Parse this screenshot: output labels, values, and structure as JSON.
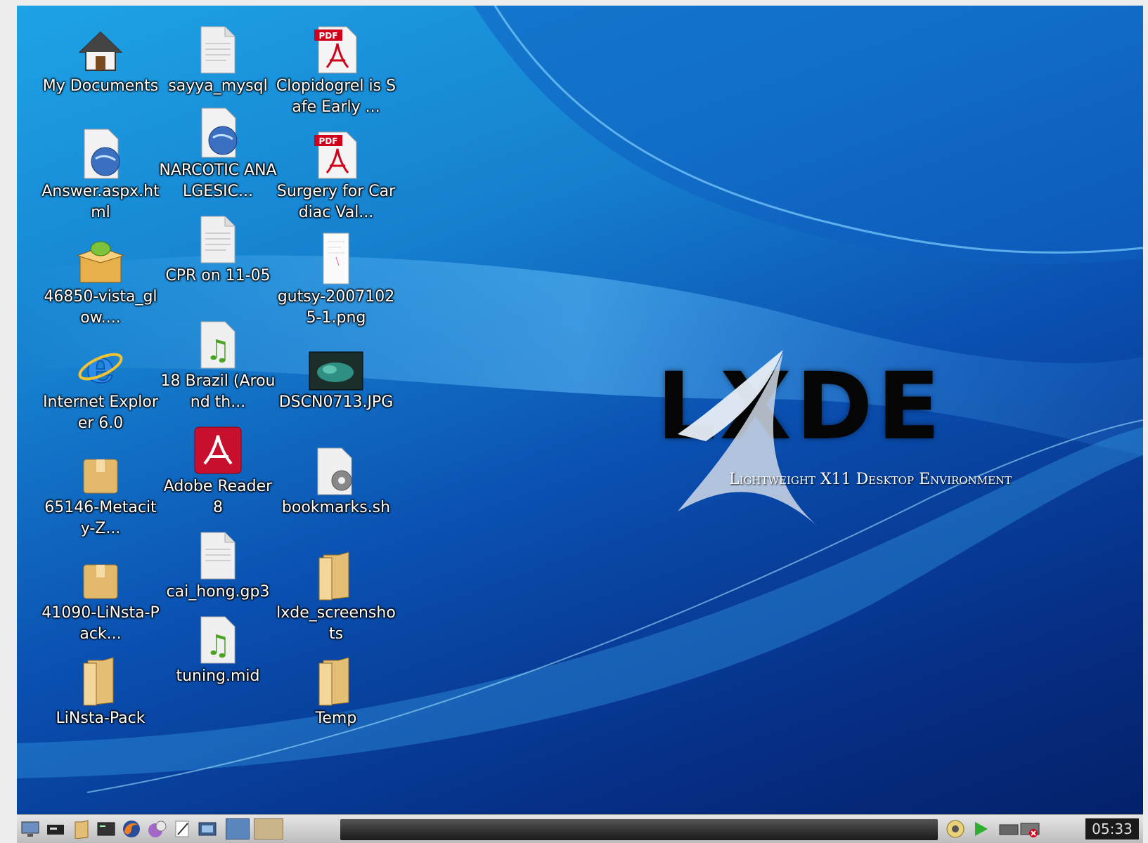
{
  "desktop": {
    "icons": [
      {
        "label": "My Documents",
        "icon": "home-icon"
      },
      {
        "label": "Answer.aspx.html",
        "icon": "html-document-icon"
      },
      {
        "label": "46850-vista_glow....",
        "icon": "package-icon"
      },
      {
        "label": "Internet Explorer 6.0",
        "icon": "internet-explorer-icon"
      },
      {
        "label": "65146-Metacity-Z...",
        "icon": "archive-icon"
      },
      {
        "label": "41090-LiNsta-Pack...",
        "icon": "archive-icon"
      },
      {
        "label": "LiNsta-Pack",
        "icon": "folder-icon"
      },
      {
        "label": "sayya_mysql",
        "icon": "text-file-icon"
      },
      {
        "label": "NARCOTIC ANALGESIC...",
        "icon": "html-document-icon"
      },
      {
        "label": "CPR on 11-05",
        "icon": "text-file-icon"
      },
      {
        "label": "18 Brazil (Around th...",
        "icon": "audio-file-icon"
      },
      {
        "label": "Adobe Reader 8",
        "icon": "adobe-reader-icon"
      },
      {
        "label": "cai_hong.gp3",
        "icon": "text-file-icon"
      },
      {
        "label": "tuning.mid",
        "icon": "audio-file-icon"
      },
      {
        "label": "Clopidogrel is Safe Early ...",
        "icon": "pdf-icon"
      },
      {
        "label": "Surgery for Cardiac Val...",
        "icon": "pdf-icon"
      },
      {
        "label": "gutsy-20071025-1.png",
        "icon": "image-file-icon"
      },
      {
        "label": "DSCN0713.JPG",
        "icon": "photo-thumbnail-icon"
      },
      {
        "label": "bookmarks.sh",
        "icon": "script-icon"
      },
      {
        "label": "lxde_screenshots",
        "icon": "folder-icon"
      },
      {
        "label": "Temp",
        "icon": "folder-icon"
      }
    ]
  },
  "wallpaper": {
    "logo_text": "LXDE",
    "subtitle": "Lightweight X11 Desktop Environment"
  },
  "taskbar": {
    "launchers": [
      "show-desktop-icon",
      "terminal-icon",
      "file-manager-icon",
      "terminal-window-icon",
      "firefox-icon",
      "media-player-icon",
      "text-editor-icon",
      "screenshot-icon",
      "workspace-1",
      "workspace-2"
    ],
    "tray": [
      "volume-icon",
      "network-icon",
      "battery-icon"
    ],
    "clock": "05:33"
  },
  "colors": {
    "taskbar_bg": "#cfcfcf",
    "clock_bg": "#1a1a1a",
    "wallpaper_light": "#1ea3e6",
    "wallpaper_dark": "#041f66"
  }
}
